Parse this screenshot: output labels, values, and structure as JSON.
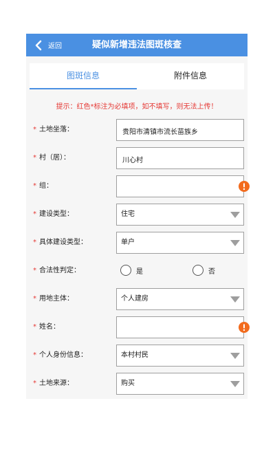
{
  "header": {
    "back_label": "返回",
    "title": "疑似新增违法图斑核查",
    "bg_color": "#4a90e2"
  },
  "tabs": [
    {
      "label": "图斑信息",
      "active": true
    },
    {
      "label": "附件信息",
      "active": false
    }
  ],
  "hint": "提示：红色*标注为必填项，如不填写，则无法上传！",
  "form": {
    "land_location": {
      "label": "土地坐落：",
      "value": "贵阳市清镇市流长苗族乡"
    },
    "village": {
      "label": "村（居）：",
      "value": "川心村"
    },
    "group": {
      "label": "组：",
      "value": ""
    },
    "build_type": {
      "label": "建设类型：",
      "value": "住宅"
    },
    "specific_build_type": {
      "label": "具体建设类型：",
      "value": "单户"
    },
    "legality": {
      "label": "合法性判定：",
      "yes": "是",
      "no": "否"
    },
    "land_user": {
      "label": "用地主体：",
      "value": "个人建房"
    },
    "name": {
      "label": "姓名：",
      "value": ""
    },
    "id_info": {
      "label": "个人身份信息：",
      "value": "本村村民"
    },
    "land_source": {
      "label": "土地来源：",
      "value": "购买"
    }
  },
  "required_mark": "*",
  "colors": {
    "required": "#e53935",
    "error": "#f26b1d",
    "dropdown": "#9e9e9e"
  }
}
